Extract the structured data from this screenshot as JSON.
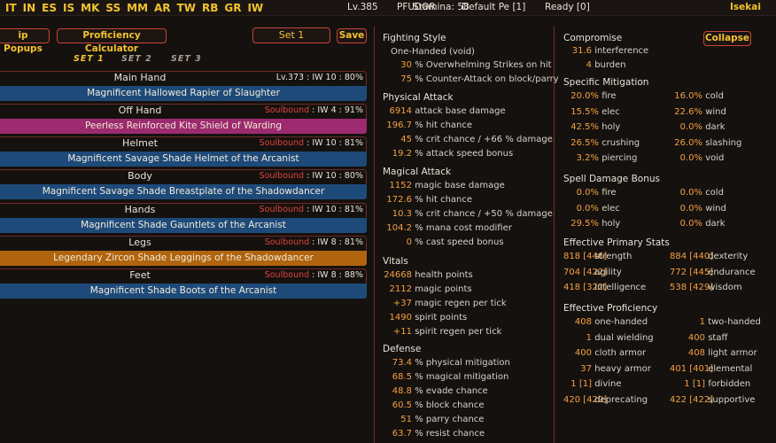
{
  "topbar": {
    "nav": [
      "IT",
      "IN",
      "ES",
      "IS",
      "MK",
      "SS",
      "MM",
      "AR",
      "TW",
      "RB",
      "GR",
      "IW"
    ],
    "stamina": "Stamina: 58",
    "level": "Lv.385",
    "character": "PFUDOR",
    "pe": "Default Pe [1]",
    "ready": "Ready [0]",
    "world": "Isekai"
  },
  "toolbar": {
    "popups_label": "ip Popups",
    "calculator_label": "Proficiency Calculator",
    "set_value": "Set 1",
    "save_label": "Save",
    "collapse_label": "Collapse"
  },
  "set_tabs": [
    "SET 1",
    "SET 2",
    "SET 3"
  ],
  "slots": [
    {
      "name": "Main Hand",
      "info_pre": "",
      "info": "Lv.373  :  IW 10  :   80%",
      "item": "Magnificent Hallowed Rapier of Slaughter",
      "color": "#1e4a7a"
    },
    {
      "name": "Off Hand",
      "info_pre": "Soulbound",
      "info": "  :   IW 4  :   91%",
      "item": "Peerless Reinforced Kite Shield of Warding",
      "color": "#9c2a6e"
    },
    {
      "name": "Helmet",
      "info_pre": "Soulbound",
      "info": "  :   IW 10  :   81%",
      "item": "Magnificent Savage Shade Helmet of the Arcanist",
      "color": "#1e4a7a"
    },
    {
      "name": "Body",
      "info_pre": "Soulbound",
      "info": "  :   IW 10  :   80%",
      "item": "Magnificent Savage Shade Breastplate of the Shadowdancer",
      "color": "#1e4a7a"
    },
    {
      "name": "Hands",
      "info_pre": "Soulbound",
      "info": "  :   IW 10  :   81%",
      "item": "Magnificent Shade Gauntlets of the Arcanist",
      "color": "#1e4a7a"
    },
    {
      "name": "Legs",
      "info_pre": "Soulbound",
      "info": "  :   IW 8  :   81%",
      "item": "Legendary Zircon Shade Leggings of the Shadowdancer",
      "color": "#b0640e"
    },
    {
      "name": "Feet",
      "info_pre": "Soulbound",
      "info": "  :   IW 8  :   88%",
      "item": "Magnificent Shade Boots of the Arcanist",
      "color": "#1e4a7a"
    }
  ],
  "mid": {
    "fighting_style": {
      "title": "Fighting Style",
      "style": "One-Handed (void)",
      "rows": [
        [
          "30",
          "% Overwhelming Strikes on hit"
        ],
        [
          "75",
          "% Counter-Attack on block/parry"
        ]
      ]
    },
    "physical": {
      "title": "Physical Attack",
      "rows": [
        [
          "6914",
          "attack base damage"
        ],
        [
          "196.7",
          "% hit chance"
        ],
        [
          "45",
          "% crit chance / +66 % damage"
        ],
        [
          "19.2",
          "% attack speed bonus"
        ]
      ]
    },
    "magical": {
      "title": "Magical Attack",
      "rows": [
        [
          "1152",
          "magic base damage"
        ],
        [
          "172.6",
          "% hit chance"
        ],
        [
          "10.3",
          "% crit chance / +50 % damage"
        ],
        [
          "104.2",
          "% mana cost modifier"
        ],
        [
          "0",
          "% cast speed bonus"
        ]
      ]
    },
    "vitals": {
      "title": "Vitals",
      "rows": [
        [
          "24668",
          "health points"
        ],
        [
          "2112",
          "magic points"
        ],
        [
          "+37",
          "magic regen per tick"
        ],
        [
          "1490",
          "spirit points"
        ],
        [
          "+11",
          "spirit regen per tick"
        ]
      ]
    },
    "defense": {
      "title": "Defense",
      "rows": [
        [
          "73.4",
          "% physical mitigation"
        ],
        [
          "68.5",
          "% magical mitigation"
        ],
        [
          "48.8",
          "% evade chance"
        ],
        [
          "60.5",
          "% block chance"
        ],
        [
          "51",
          "% parry chance"
        ],
        [
          "63.7",
          "% resist chance"
        ]
      ]
    }
  },
  "right": {
    "compromise": {
      "title": "Compromise",
      "rows": [
        [
          "31.6",
          "interference"
        ],
        [
          "4",
          "burden"
        ]
      ]
    },
    "mitigation": {
      "title": "Specific Mitigation",
      "rows": [
        [
          "20.0%",
          "fire",
          "16.0%",
          "cold"
        ],
        [
          "15.5%",
          "elec",
          "22.6%",
          "wind"
        ],
        [
          "42.5%",
          "holy",
          "0.0%",
          "dark"
        ],
        [
          "26.5%",
          "crushing",
          "26.0%",
          "slashing"
        ],
        [
          "3.2%",
          "piercing",
          "0.0%",
          "void"
        ]
      ]
    },
    "spell": {
      "title": "Spell Damage Bonus",
      "rows": [
        [
          "0.0%",
          "fire",
          "0.0%",
          "cold"
        ],
        [
          "0.0%",
          "elec",
          "0.0%",
          "wind"
        ],
        [
          "29.5%",
          "holy",
          "0.0%",
          "dark"
        ]
      ]
    },
    "primary": {
      "title": "Effective Primary Stats",
      "rows": [
        [
          "818 [446]",
          "strength",
          "884 [440]",
          "dexterity"
        ],
        [
          "704 [422]",
          "agility",
          "772 [445]",
          "endurance"
        ],
        [
          "418 [322]",
          "intelligence",
          "538 [429]",
          "wisdom"
        ]
      ]
    },
    "proficiency": {
      "title": "Effective Proficiency",
      "rows": [
        [
          "408",
          "one-handed",
          "1",
          "two-handed"
        ],
        [
          "1",
          "dual wielding",
          "400",
          "staff"
        ],
        [
          "400",
          "cloth armor",
          "408",
          "light armor"
        ],
        [
          "37",
          "heavy armor",
          "401 [401]",
          "elemental"
        ],
        [
          "1 [1]",
          "divine",
          "1 [1]",
          "forbidden"
        ],
        [
          "420 [420]",
          "deprecating",
          "422 [422]",
          "supportive"
        ]
      ]
    }
  }
}
